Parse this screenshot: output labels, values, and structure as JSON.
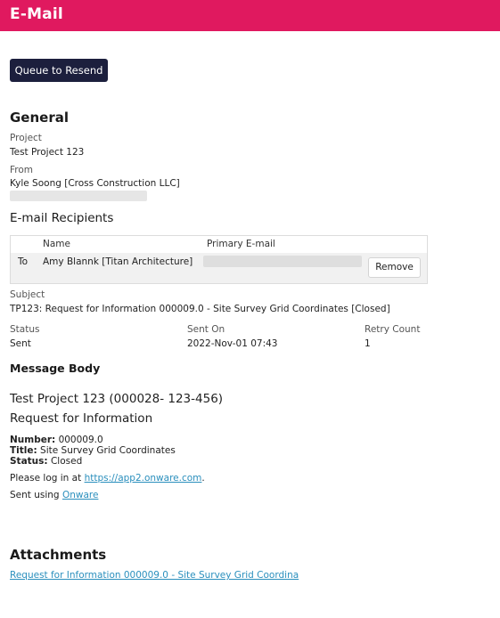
{
  "header": {
    "title": "E-Mail",
    "color": "#e0195f"
  },
  "actions": {
    "queue_resend": "Queue to Resend"
  },
  "general": {
    "heading": "General",
    "project_label": "Project",
    "project_value": "Test Project 123",
    "from_label": "From",
    "from_value": "Kyle Soong [Cross Construction LLC]"
  },
  "recipients": {
    "heading": "E-mail Recipients",
    "columns": {
      "name": "Name",
      "email": "Primary E-mail"
    },
    "rows": [
      {
        "type": "To",
        "name": "Amy Blannk [Titan Architecture]",
        "remove": "Remove"
      }
    ]
  },
  "subject": {
    "label": "Subject",
    "value": "TP123: Request for Information 000009.0 - Site Survey Grid Coordinates [Closed]"
  },
  "meta": {
    "status_label": "Status",
    "status_value": "Sent",
    "sent_on_label": "Sent On",
    "sent_on_value": "2022-Nov-01 07:43",
    "retry_label": "Retry Count",
    "retry_value": "1"
  },
  "message": {
    "heading": "Message Body",
    "project_line": "Test Project 123 (000028- 123-456)",
    "doc_type": "Request for Information",
    "number_label": "Number:",
    "number_value": "000009.0",
    "title_label": "Title:",
    "title_value": "Site Survey Grid Coordinates",
    "status_label": "Status:",
    "status_value": "Closed",
    "login_prefix": "Please log in at ",
    "login_link": "https://app2.onware.com",
    "login_suffix": ".",
    "sent_prefix": "Sent using ",
    "sent_link": "Onware"
  },
  "attachments": {
    "heading": "Attachments",
    "items": [
      "Request for Information 000009.0 - Site Survey Grid Coordina"
    ]
  },
  "colors": {
    "accent": "#e0195f",
    "button_dark": "#1c1f3d",
    "link": "#2a8fbd"
  }
}
